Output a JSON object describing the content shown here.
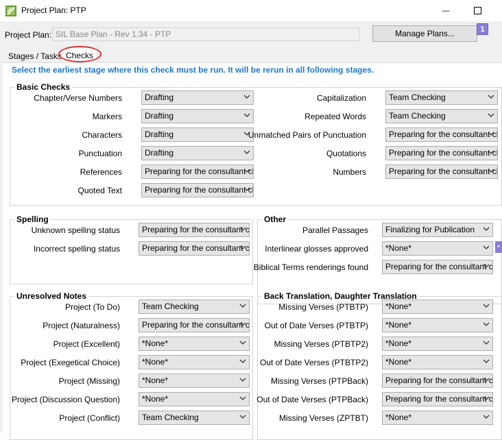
{
  "window": {
    "title": "Project Plan: PTP",
    "minimize_glyph": "—",
    "maximize_glyph": "☐"
  },
  "plan": {
    "label": "Project Plan:",
    "value": "SIL Base Plan - Rev 1.34 - PTP",
    "manage_button": "Manage Plans...",
    "badge": "1",
    "side_badge": "*"
  },
  "tabs": {
    "stages": "Stages / Tasks",
    "checks": "Checks"
  },
  "instruction": "Select the earliest stage where this check must be run. It will be rerun in all following stages.",
  "basic_checks": {
    "title": "Basic Checks",
    "left": [
      {
        "label": "Chapter/Verse Numbers",
        "value": "Drafting"
      },
      {
        "label": "Markers",
        "value": "Drafting"
      },
      {
        "label": "Characters",
        "value": "Drafting"
      },
      {
        "label": "Punctuation",
        "value": "Drafting"
      },
      {
        "label": "References",
        "value": "Preparing for the consultant cl"
      },
      {
        "label": "Quoted Text",
        "value": "Preparing for the consultant cl"
      }
    ],
    "right": [
      {
        "label": "Capitalization",
        "value": "Team Checking"
      },
      {
        "label": "Repeated Words",
        "value": "Team Checking"
      },
      {
        "label": "Unmatched Pairs of Punctuation",
        "value": "Preparing for the consultant cl"
      },
      {
        "label": "Quotations",
        "value": "Preparing for the consultant cl"
      },
      {
        "label": "Numbers",
        "value": "Preparing for the consultant cl"
      }
    ]
  },
  "spelling": {
    "title": "Spelling",
    "rows": [
      {
        "label": "Unknown spelling status",
        "value": "Preparing for the consultant c"
      },
      {
        "label": "Incorrect spelling status",
        "value": "Preparing for the consultant c"
      }
    ]
  },
  "other": {
    "title": "Other",
    "rows": [
      {
        "label": "Parallel Passages",
        "value": "Finalizing for Publication"
      },
      {
        "label": "Interlinear glosses approved",
        "value": "*None*"
      },
      {
        "label": "Biblical Terms renderings found",
        "value": "Preparing for the consultant c"
      }
    ]
  },
  "unresolved": {
    "title": "Unresolved Notes",
    "rows": [
      {
        "label": "Project (To Do)",
        "value": "Team Checking"
      },
      {
        "label": "Project (Naturalness)",
        "value": "Preparing for the consultant c"
      },
      {
        "label": "Project (Excellent)",
        "value": "*None*"
      },
      {
        "label": "Project (Exegetical Choice)",
        "value": "*None*"
      },
      {
        "label": "Project (Missing)",
        "value": "*None*"
      },
      {
        "label": "Project (Discussion Question)",
        "value": "*None*"
      },
      {
        "label": "Project (Conflict)",
        "value": "Team Checking"
      }
    ]
  },
  "back_translation": {
    "title": "Back Translation, Daughter Translation",
    "rows": [
      {
        "label": "Missing Verses (PTBTP)",
        "value": "*None*"
      },
      {
        "label": "Out of Date Verses (PTBTP)",
        "value": "*None*"
      },
      {
        "label": "Missing Verses (PTBTP2)",
        "value": "*None*"
      },
      {
        "label": "Out of Date Verses (PTBTP2)",
        "value": "*None*"
      },
      {
        "label": "Missing Verses (PTPBack)",
        "value": "Preparing for the consultant c"
      },
      {
        "label": "Out of Date Verses (PTPBack)",
        "value": "Preparing for the consultant c"
      },
      {
        "label": "Missing Verses (ZPTBT)",
        "value": "*None*"
      }
    ]
  },
  "colors": {
    "accent": "#1e77c9",
    "highlight_circle": "#e03030",
    "badge": "#8a7fd8"
  },
  "icons": {
    "app": "project-plan-icon",
    "dropdown": "chevron-down-icon"
  }
}
